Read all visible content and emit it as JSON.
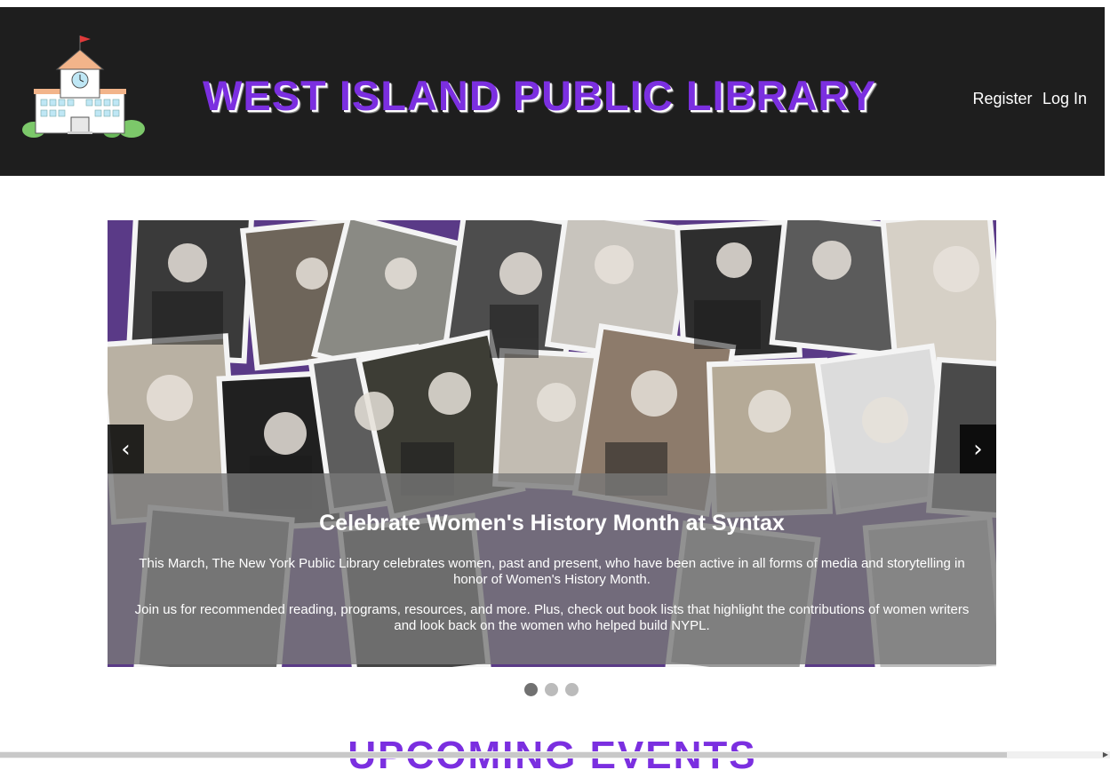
{
  "header": {
    "site_title": "WEST ISLAND PUBLIC LIBRARY",
    "logo_icon": "library-building-icon",
    "register_label": "Register",
    "login_label": "Log In"
  },
  "carousel": {
    "prev_label": "‹",
    "next_label": "›",
    "slide_count": 3,
    "active_slide": 1,
    "caption_title": "Celebrate Women's History Month at Syntax",
    "caption_p1": "This March, The New York Public Library celebrates women, past and present, who have been active in all forms of media and storytelling in honor of Women's History Month.",
    "caption_p2": "Join us for recommended reading, programs, resources, and more. Plus, check out book lists that highlight the contributions of women writers and look back on the women who helped build NYPL."
  },
  "section": {
    "heading": "UPCOMING EVENTS"
  },
  "colors": {
    "header_bg": "#1e1e1e",
    "title_purple": "#7b2fe0",
    "collage_purple": "#5a3a87"
  }
}
